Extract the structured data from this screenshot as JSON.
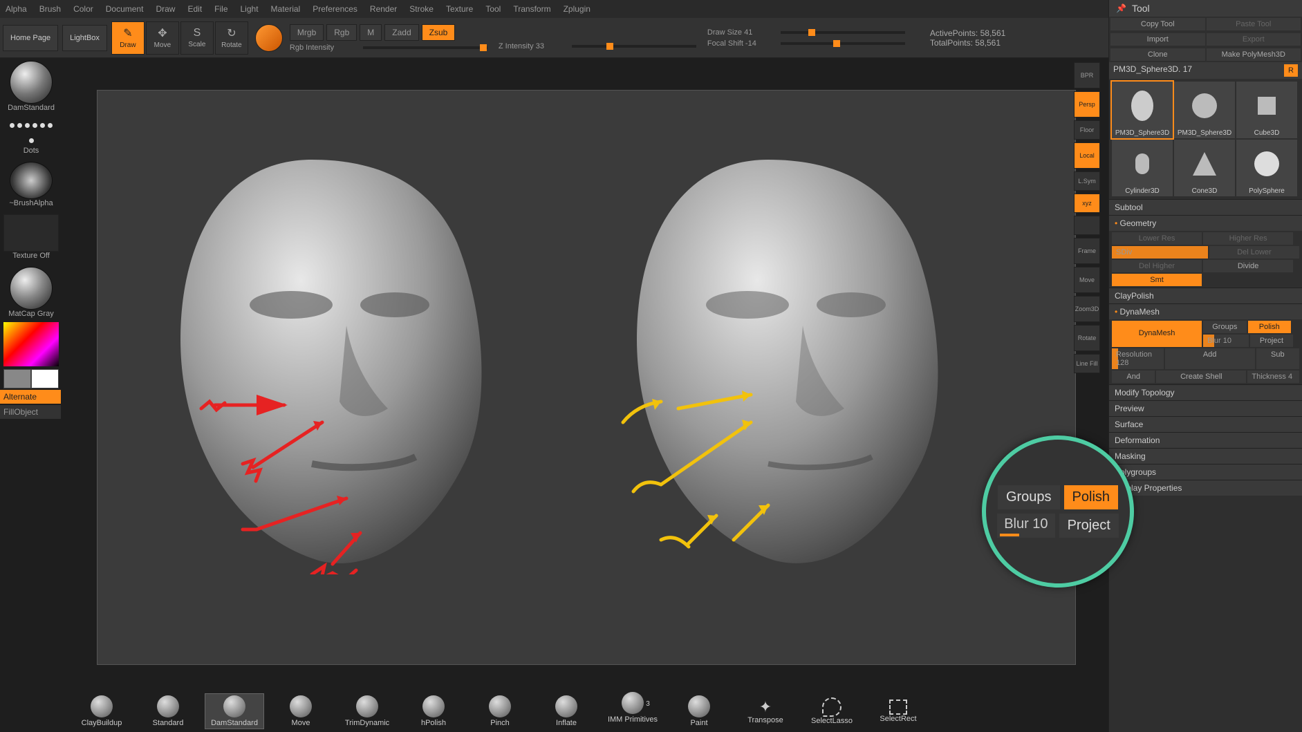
{
  "menu": [
    "Alpha",
    "Brush",
    "Color",
    "Document",
    "Draw",
    "Edit",
    "File",
    "Light",
    "Material",
    "Preferences",
    "Render",
    "Stroke",
    "Texture",
    "Tool",
    "Transform",
    "Zplugin"
  ],
  "topbar": {
    "homepage": "Home Page",
    "lightbox": "LightBox",
    "modes": [
      {
        "label": "Draw",
        "glyph": "✎",
        "active": true
      },
      {
        "label": "Move",
        "glyph": "✥",
        "active": false
      },
      {
        "label": "Scale",
        "glyph": "S",
        "active": false
      },
      {
        "label": "Rotate",
        "glyph": "↻",
        "active": false
      }
    ],
    "toggles": [
      {
        "label": "Mrgb",
        "on": false
      },
      {
        "label": "Rgb",
        "on": false
      },
      {
        "label": "M",
        "on": false
      },
      {
        "label": "Zadd",
        "on": false
      },
      {
        "label": "Zsub",
        "on": true
      }
    ],
    "sliders": {
      "rgb_intensity": {
        "label": "Rgb Intensity",
        "value": "",
        "pos": 94
      },
      "z_intensity": {
        "label": "Z Intensity 33",
        "value": "33",
        "pos": 28
      },
      "draw_size": {
        "label": "Draw Size 41",
        "value": "41",
        "pos": 22
      },
      "focal_shift": {
        "label": "Focal Shift -14",
        "value": "-14",
        "pos": 42
      }
    },
    "stats": {
      "active_label": "ActivePoints:",
      "active_value": "58,561",
      "total_label": "TotalPoints:",
      "total_value": "58,561"
    }
  },
  "left": {
    "brush": "DamStandard",
    "stroke": "Dots",
    "alpha": "~BrushAlpha",
    "texture": "Texture Off",
    "material": "MatCap Gray",
    "alternate": "Alternate",
    "fill": "FillObject"
  },
  "rstrip": [
    {
      "label": "BPR",
      "on": false,
      "sm": false
    },
    {
      "label": "Persp",
      "on": true,
      "sm": false
    },
    {
      "label": "Floor",
      "on": false,
      "sm": true
    },
    {
      "label": "Local",
      "on": true,
      "sm": false
    },
    {
      "label": "L.Sym",
      "on": false,
      "sm": true
    },
    {
      "label": "xyz",
      "on": true,
      "sm": true
    },
    {
      "label": "",
      "on": false,
      "sm": true
    },
    {
      "label": "Frame",
      "on": false,
      "sm": false
    },
    {
      "label": "Move",
      "on": false,
      "sm": false
    },
    {
      "label": "Zoom3D",
      "on": false,
      "sm": false
    },
    {
      "label": "Rotate",
      "on": false,
      "sm": false
    },
    {
      "label": "Line Fill",
      "on": false,
      "sm": true
    }
  ],
  "tool": {
    "title": "Tool",
    "buttons_top": [
      [
        "Copy Tool",
        "Paste Tool"
      ],
      [
        "Import",
        "Export"
      ],
      [
        "Clone",
        "Make PolyMesh3D"
      ]
    ],
    "tool_name": "PM3D_Sphere3D. 17",
    "r_btn": "R",
    "thumbs": [
      {
        "label": "PM3D_Sphere3D",
        "sel": true,
        "shape": "head"
      },
      {
        "label": "PM3D_Sphere3D",
        "shape": "poly"
      },
      {
        "label": "Cube3D",
        "shape": "cube"
      },
      {
        "label": "Cylinder3D",
        "shape": "cyl"
      },
      {
        "label": "Cone3D",
        "shape": "cone"
      },
      {
        "label": "PolySphere",
        "shape": "sphere"
      }
    ],
    "sections_closed": [
      "Subtool"
    ],
    "geometry": {
      "title": "Geometry",
      "lower": "Lower Res",
      "higher": "Higher Res",
      "sdiv": "SDiv",
      "del_lower": "Del Lower",
      "del_higher": "Del Higher",
      "divide": "Divide",
      "smt": "Smt",
      "claypolish": "ClayPolish",
      "dynamesh": {
        "title": "DynaMesh",
        "btn": "DynaMesh",
        "groups": "Groups",
        "polish": "Polish",
        "blur": "Blur 10",
        "project": "Project",
        "resolution": "Resolution 128",
        "add": "Add",
        "sub": "Sub",
        "and": "And",
        "create_shell": "Create Shell",
        "thickness": "Thickness 4"
      },
      "modify_topology": "Modify Topology"
    },
    "sections_after": [
      "Preview",
      "Surface",
      "Deformation",
      "Masking",
      "Polygroups",
      "Display Properties"
    ]
  },
  "shelf": [
    {
      "label": "ClayBuildup"
    },
    {
      "label": "Standard"
    },
    {
      "label": "DamStandard",
      "sel": true
    },
    {
      "label": "Move"
    },
    {
      "label": "TrimDynamic"
    },
    {
      "label": "hPolish"
    },
    {
      "label": "Pinch"
    },
    {
      "label": "Inflate"
    },
    {
      "label": "IMM Primitives",
      "badge": "3"
    },
    {
      "label": "Paint"
    },
    {
      "label": "Transpose",
      "icon": "gizmo"
    },
    {
      "label": "SelectLasso",
      "icon": "lasso"
    },
    {
      "label": "SelectRect",
      "icon": "rect"
    }
  ],
  "zoom": {
    "groups": "Groups",
    "polish": "Polish",
    "blur": "Blur 10",
    "project": "Project"
  }
}
